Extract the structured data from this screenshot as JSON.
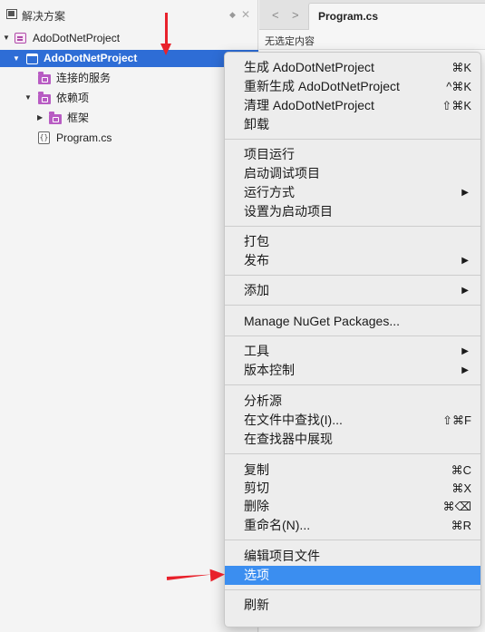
{
  "pad": {
    "title": "解决方案",
    "tree": {
      "solution": "AdoDotNetProject",
      "project": "AdoDotNetProject",
      "connected_services": "连接的服务",
      "dependencies": "依赖项",
      "frameworks": "框架",
      "file": "Program.cs"
    }
  },
  "editor": {
    "tab_label": "Program.cs",
    "breadcrumb": "无选定内容",
    "nav_back": "<",
    "nav_forward": ">"
  },
  "menu": {
    "items": [
      {
        "label": "生成 AdoDotNetProject",
        "shortcut": "⌘K"
      },
      {
        "label": "重新生成 AdoDotNetProject",
        "shortcut": "^⌘K"
      },
      {
        "label": "清理 AdoDotNetProject",
        "shortcut": "⇧⌘K"
      },
      {
        "label": "卸载",
        "shortcut": ""
      },
      {
        "label": "项目运行",
        "shortcut": ""
      },
      {
        "label": "启动调试项目",
        "shortcut": ""
      },
      {
        "label": "运行方式",
        "shortcut": ""
      },
      {
        "label": "设置为启动项目",
        "shortcut": ""
      },
      {
        "label": "打包",
        "shortcut": ""
      },
      {
        "label": "发布",
        "shortcut": ""
      },
      {
        "label": "添加",
        "shortcut": ""
      },
      {
        "label": "Manage NuGet Packages...",
        "shortcut": ""
      },
      {
        "label": "工具",
        "shortcut": ""
      },
      {
        "label": "版本控制",
        "shortcut": ""
      },
      {
        "label": "分析源",
        "shortcut": ""
      },
      {
        "label": "在文件中查找(I)...",
        "shortcut": "⇧⌘F"
      },
      {
        "label": "在查找器中展现",
        "shortcut": ""
      },
      {
        "label": "复制",
        "shortcut": "⌘C"
      },
      {
        "label": "剪切",
        "shortcut": "⌘X"
      },
      {
        "label": "删除",
        "shortcut": "⌘⌫"
      },
      {
        "label": "重命名(N)...",
        "shortcut": "⌘R"
      },
      {
        "label": "编辑项目文件",
        "shortcut": ""
      },
      {
        "label": "选项",
        "shortcut": ""
      },
      {
        "label": "刷新",
        "shortcut": ""
      }
    ],
    "submenu_arrow": "▶",
    "highlighted_item": "选项"
  },
  "colors": {
    "selection": "#2e6dd6",
    "menu_highlight": "#3b8ef0",
    "annotation": "#e8212b"
  }
}
